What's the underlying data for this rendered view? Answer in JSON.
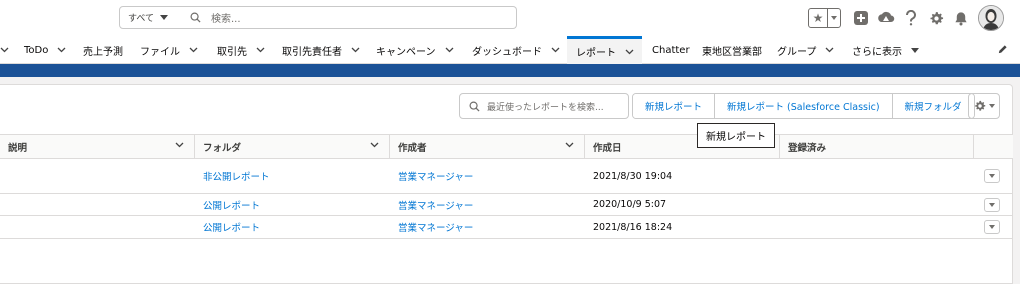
{
  "header": {
    "search_scope": "すべて",
    "search_placeholder": "検索..."
  },
  "nav": {
    "items": [
      {
        "label": "ToDo"
      },
      {
        "label": "売上予測"
      },
      {
        "label": "ファイル"
      },
      {
        "label": "取引先"
      },
      {
        "label": "取引先責任者"
      },
      {
        "label": "キャンペーン"
      },
      {
        "label": "ダッシュボード"
      },
      {
        "label": "レポート",
        "active": true
      },
      {
        "label": "Chatter"
      },
      {
        "label": "東地区営業部"
      },
      {
        "label": "グループ"
      },
      {
        "label": "さらに表示"
      }
    ]
  },
  "toolbar": {
    "search_placeholder": "最近使ったレポートを検索...",
    "new_report": "新規レポート",
    "new_report_classic": "新規レポート (Salesforce Classic)",
    "new_folder": "新規フォルダ"
  },
  "table": {
    "headers": [
      "説明",
      "フォルダ",
      "作成者",
      "作成日",
      "登録済み"
    ],
    "rows": [
      {
        "description": "",
        "folder": "非公開レポート",
        "created_by": "営業マネージャー",
        "created_date": "2021/8/30 19:04",
        "subscribed": ""
      },
      {
        "description": "",
        "folder": "公開レポート",
        "created_by": "営業マネージャー",
        "created_date": "2020/10/9 5:07",
        "subscribed": ""
      },
      {
        "description": "",
        "folder": "公開レポート",
        "created_by": "営業マネージャー",
        "created_date": "2021/8/16 18:24",
        "subscribed": ""
      }
    ]
  },
  "tooltip": {
    "text": "新規レポート"
  },
  "colors": {
    "brand_band": "#1b5297",
    "link": "#0176d3",
    "active_tab_border": "#0176d3"
  },
  "icons": [
    "search-icon",
    "star-icon",
    "add-icon",
    "trailhead-icon",
    "help-icon",
    "gear-icon",
    "bell-icon",
    "avatar",
    "pencil-icon",
    "chevron-down-icon"
  ]
}
